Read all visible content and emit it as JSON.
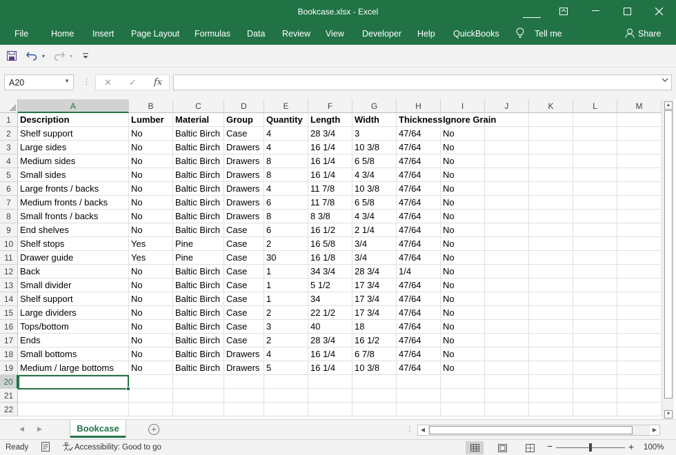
{
  "window": {
    "title": "Bookcase.xlsx  -  Excel",
    "colors": {
      "accent": "#217346",
      "ribbon_bg": "#217346",
      "chrome_bg": "#f3f3f3"
    }
  },
  "menu": {
    "items": [
      "File",
      "Home",
      "Insert",
      "Page Layout",
      "Formulas",
      "Data",
      "Review",
      "View",
      "Developer",
      "Help",
      "QuickBooks"
    ],
    "tell_me": "Tell me",
    "share": "Share"
  },
  "qat": {
    "icons": [
      "save-icon",
      "undo-icon",
      "redo-icon",
      "customize-icon"
    ]
  },
  "formula_bar": {
    "name_box": "A20",
    "fx_label": "fx",
    "formula_value": ""
  },
  "sheet": {
    "columns": [
      "A",
      "B",
      "C",
      "D",
      "E",
      "F",
      "G",
      "H",
      "I",
      "J",
      "K",
      "L",
      "M"
    ],
    "row_numbers": [
      "1",
      "2",
      "3",
      "4",
      "5",
      "6",
      "7",
      "8",
      "9",
      "10",
      "11",
      "12",
      "13",
      "14",
      "15",
      "16",
      "17",
      "18",
      "19",
      "20",
      "21",
      "22"
    ],
    "headers": [
      "Description",
      "Lumber",
      "Material",
      "Group",
      "Quantity",
      "Length",
      "Width",
      "Thickness",
      "Ignore Grain"
    ],
    "rows": [
      [
        "Shelf support",
        "No",
        "Baltic Birch",
        "Case",
        "4",
        "28 3/4",
        "3",
        "47/64",
        "No"
      ],
      [
        "Large sides",
        "No",
        "Baltic Birch",
        "Drawers",
        "4",
        "16 1/4",
        "10 3/8",
        "47/64",
        "No"
      ],
      [
        "Medium sides",
        "No",
        "Baltic Birch",
        "Drawers",
        "8",
        "16 1/4",
        "6 5/8",
        "47/64",
        "No"
      ],
      [
        "Small sides",
        "No",
        "Baltic Birch",
        "Drawers",
        "8",
        "16 1/4",
        "4 3/4",
        "47/64",
        "No"
      ],
      [
        "Large fronts / backs",
        "No",
        "Baltic Birch",
        "Drawers",
        "4",
        "11 7/8",
        "10 3/8",
        "47/64",
        "No"
      ],
      [
        "Medium fronts / backs",
        "No",
        "Baltic Birch",
        "Drawers",
        "6",
        "11 7/8",
        "6 5/8",
        "47/64",
        "No"
      ],
      [
        "Small fronts / backs",
        "No",
        "Baltic Birch",
        "Drawers",
        "8",
        "8 3/8",
        "4 3/4",
        "47/64",
        "No"
      ],
      [
        "End shelves",
        "No",
        "Baltic Birch",
        "Case",
        "6",
        "16 1/2",
        "2 1/4",
        "47/64",
        "No"
      ],
      [
        "Shelf stops",
        "Yes",
        "Pine",
        "Case",
        "2",
        "16 5/8",
        " 3/4",
        "47/64",
        "No"
      ],
      [
        "Drawer guide",
        "Yes",
        "Pine",
        "Case",
        "30",
        "16 1/8",
        " 3/4",
        "47/64",
        "No"
      ],
      [
        "Back",
        "No",
        "Baltic Birch",
        "Case",
        "1",
        "34 3/4",
        "28 3/4",
        "1/4",
        "No"
      ],
      [
        "Small divider",
        "No",
        "Baltic Birch",
        "Case",
        "1",
        "5 1/2",
        "17 3/4",
        "47/64",
        "No"
      ],
      [
        "Shelf support",
        "No",
        "Baltic Birch",
        "Case",
        "1",
        "34",
        "17 3/4",
        "47/64",
        "No"
      ],
      [
        "Large dividers",
        "No",
        "Baltic Birch",
        "Case",
        "2",
        "22 1/2",
        "17 3/4",
        "47/64",
        "No"
      ],
      [
        "Tops/bottom",
        "No",
        "Baltic Birch",
        "Case",
        "3",
        "40",
        "18",
        "47/64",
        "No"
      ],
      [
        "Ends",
        "No",
        "Baltic Birch",
        "Case",
        "2",
        "28 3/4",
        "16 1/2",
        "47/64",
        "No"
      ],
      [
        "Small bottoms",
        "No",
        "Baltic Birch",
        "Drawers",
        "4",
        "16 1/4",
        "6 7/8",
        "47/64",
        "No"
      ],
      [
        "Medium / large bottoms",
        "No",
        "Baltic Birch",
        "Drawers",
        "5",
        "16 1/4",
        "10 3/8",
        "47/64",
        "No"
      ]
    ]
  },
  "tabs": {
    "active": "Bookcase"
  },
  "status": {
    "ready": "Ready",
    "accessibility": "Accessibility: Good to go",
    "zoom": "100%"
  }
}
